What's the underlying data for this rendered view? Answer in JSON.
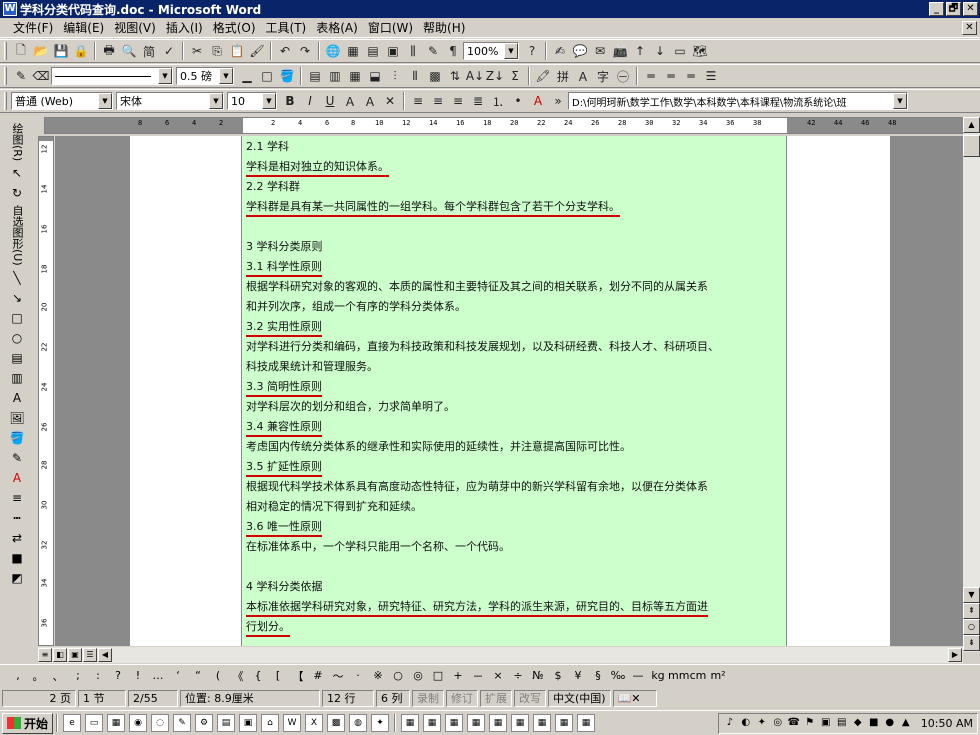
{
  "window": {
    "title": "学科分类代码查询.doc - Microsoft Word",
    "min": "_",
    "max": "🗗",
    "close": "✕"
  },
  "menu": [
    "文件(F)",
    "编辑(E)",
    "视图(V)",
    "插入(I)",
    "格式(O)",
    "工具(T)",
    "表格(A)",
    "窗口(W)",
    "帮助(H)"
  ],
  "toolbar1": {
    "zoom": "100%",
    "zoom_arrow": "▼"
  },
  "toolbar2": {
    "line_weight": "0.5 磅"
  },
  "format_bar": {
    "style": "普通 (Web)",
    "font": "宋体",
    "size": "10",
    "path": "D:\\何明珂新\\数学工作\\数学\\本科数学\\本科课程\\物流系统论\\班"
  },
  "ruler_ticks": [
    "8",
    "6",
    "4",
    "2",
    "2",
    "4",
    "6",
    "8",
    "10",
    "12",
    "14",
    "16",
    "18",
    "20",
    "22",
    "24",
    "26",
    "28",
    "30",
    "32",
    "34",
    "36",
    "38",
    "42",
    "44",
    "46",
    "48"
  ],
  "vruler_ticks": [
    "12",
    "14",
    "16",
    "18",
    "20",
    "22",
    "24",
    "26",
    "28",
    "30",
    "32",
    "34",
    "36"
  ],
  "drawbar": {
    "label_top": "绘图(R)",
    "label_auto": "自选图形(U)"
  },
  "document": {
    "lines": [
      {
        "text": "2.1 学科",
        "ul": false
      },
      {
        "text": "学科是相对独立的知识体系。",
        "ul": true
      },
      {
        "text": "2.2 学科群",
        "ul": false
      },
      {
        "text": "学科群是具有某一共同属性的一组学科。每个学科群包含了若干个分支学科。",
        "ul": true
      },
      {
        "text": "",
        "ul": false
      },
      {
        "text": "3 学科分类原则",
        "ul": false
      },
      {
        "text": "3.1 科学性原则",
        "ul": true
      },
      {
        "text": "根据学科研究对象的客观的、本质的属性和主要特征及其之间的相关联系，划分不同的从属关系",
        "ul": false
      },
      {
        "text": "和并列次序，组成一个有序的学科分类体系。",
        "ul": false
      },
      {
        "text": "3.2 实用性原则",
        "ul": true
      },
      {
        "text": "对学科进行分类和编码，直接为科技政策和科技发展规划，以及科研经费、科技人才、科研项目、",
        "ul": false
      },
      {
        "text": "科技成果统计和管理服务。",
        "ul": false
      },
      {
        "text": "3.3 简明性原则",
        "ul": true
      },
      {
        "text": "对学科层次的划分和组合，力求简单明了。",
        "ul": false
      },
      {
        "text": "3.4 兼容性原则",
        "ul": true
      },
      {
        "text": "考虑国内传统分类体系的继承性和实际使用的延续性，并注意提高国际可比性。",
        "ul": false
      },
      {
        "text": "3.5 扩延性原则",
        "ul": true
      },
      {
        "text": "根据现代科学技术体系具有高度动态性特征，应为萌芽中的新兴学科留有余地，以便在分类体系",
        "ul": false
      },
      {
        "text": "相对稳定的情况下得到扩充和延续。",
        "ul": false
      },
      {
        "text": "3.6 唯一性原则",
        "ul": true
      },
      {
        "text": "在标准体系中，一个学科只能用一个名称、一个代码。",
        "ul": false
      },
      {
        "text": "",
        "ul": false
      },
      {
        "text": "4 学科分类依据",
        "ul": false
      },
      {
        "text": "本标准依据学科研究对象，研究特征、研究方法，学科的派生来源，研究目的、目标等五方面进",
        "ul": true
      },
      {
        "text": "行划分。",
        "ul": true
      }
    ]
  },
  "symbols": [
    ",",
    "。",
    "、",
    ";",
    ":",
    "?",
    "!",
    "…",
    "‘",
    "“",
    "(",
    "《",
    "{",
    "[",
    "【",
    "#",
    "～",
    "·",
    "※",
    "○",
    "◎",
    "□",
    "+",
    "－",
    "×",
    "÷",
    "№",
    "$",
    "¥",
    "§",
    "‰",
    "—",
    "kg",
    "mm",
    "cm",
    "m²"
  ],
  "status": {
    "page": "2 页",
    "section": "1 节",
    "of": "2/55",
    "position": "位置: 8.9厘米",
    "line": "12 行",
    "col": "6 列",
    "rec": "录制",
    "trk": "修订",
    "ext": "扩展",
    "ovr": "改写",
    "lang": "中文(中国)"
  },
  "taskbar": {
    "start": "开始",
    "clock": "10:50 AM"
  }
}
